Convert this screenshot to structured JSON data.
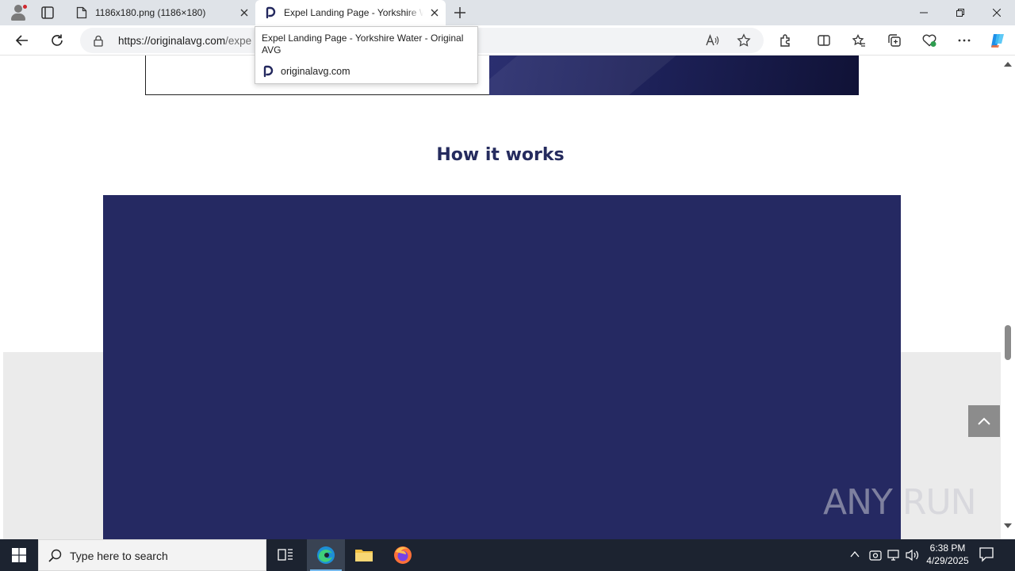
{
  "browser": {
    "tabs": [
      {
        "title": "1186x180.png (1186×180)",
        "icon": "file-icon"
      },
      {
        "title": "Expel Landing Page - Yorkshire Water - Original AVG",
        "icon": "site-favicon-icon",
        "active": true
      }
    ],
    "address": {
      "host": "https://originalavg.com",
      "path": "/expe"
    },
    "tooltip": {
      "title": "Expel Landing Page - Yorkshire Water - Original AVG",
      "domain": "originalavg.com"
    }
  },
  "page": {
    "section_title": "How it works",
    "video_color": "#252962",
    "accent_color": "#252b5e"
  },
  "watermark": "ANY RUN",
  "taskbar": {
    "search_placeholder": "Type here to search",
    "time": "6:38 PM",
    "date": "4/29/2025"
  }
}
